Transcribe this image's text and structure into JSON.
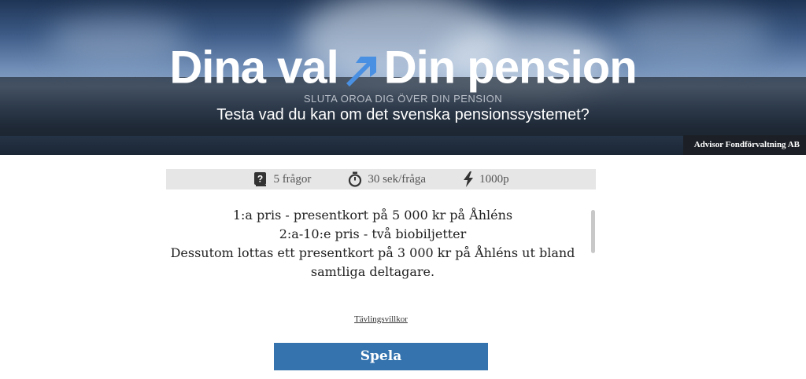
{
  "hero": {
    "title_part1": "Dina val",
    "title_part2": "Din pension",
    "subtitle": "SLUTA OROA DIG ÖVER DIN PENSION",
    "question": "Testa vad du kan om det svenska pensionssystemet?",
    "company": "Advisor Fondförvaltning AB",
    "arrow_color": "#4a90e2"
  },
  "info": {
    "questions": "5 frågor",
    "questions_icon": "question-book-icon",
    "time": "30 sek/fråga",
    "time_icon": "stopwatch-icon",
    "points": "1000p",
    "points_icon": "lightning-icon"
  },
  "prizes": {
    "line1": "1:a pris - presentkort på 5 000 kr på Åhléns",
    "line2": "2:a-10:e pris - två biobiljetter",
    "line3": "Dessutom lottas ett presentkort på 3 000 kr på Åhléns ut bland samtliga deltagare."
  },
  "terms_link": "Tävlingsvillkor",
  "play_button": "Spela",
  "colors": {
    "button": "#3473ae",
    "info_bar": "#e6e6e6"
  }
}
